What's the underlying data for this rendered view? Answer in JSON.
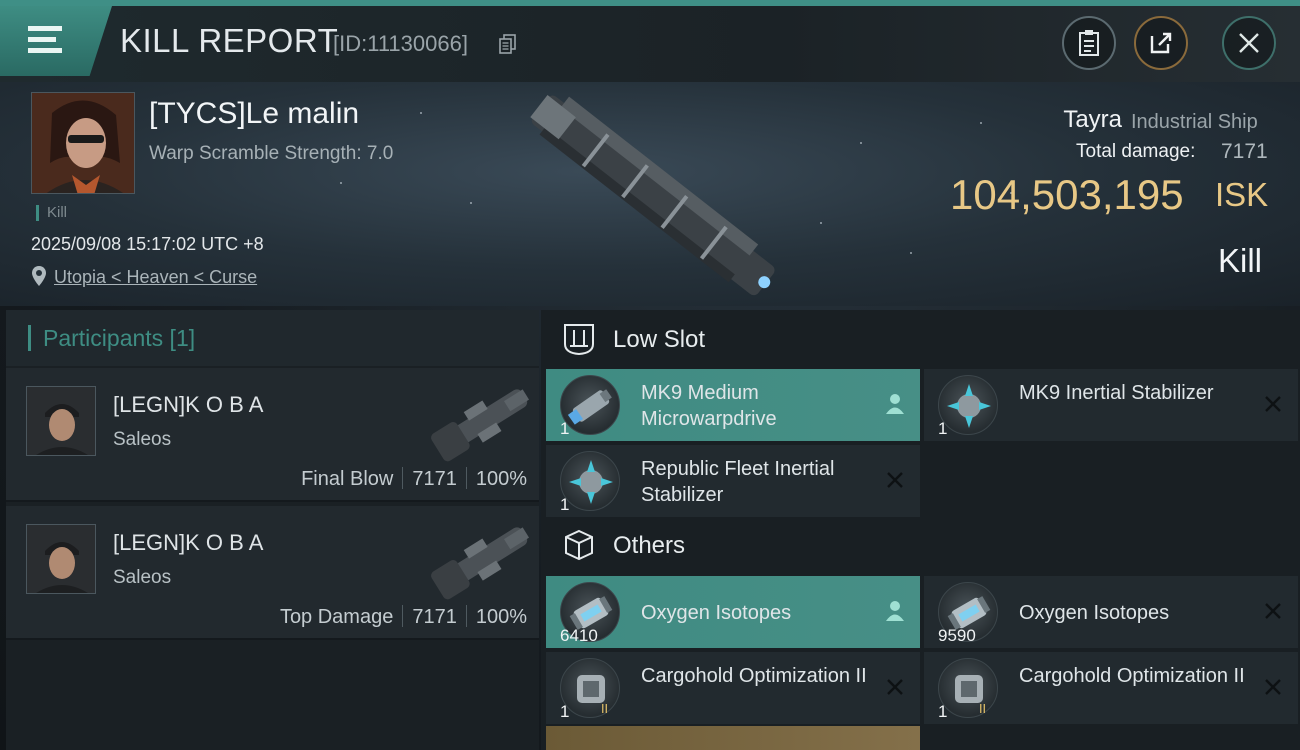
{
  "header": {
    "title": "KILL REPORT",
    "report_id": "[ID:11130066]"
  },
  "victim": {
    "name": "[TYCS]Le malin",
    "warp_scramble": "Warp Scramble Strength: 7.0",
    "tag": "Kill",
    "datetime": "2025/09/08 15:17:02 UTC +8",
    "location": "Utopia < Heaven < Curse"
  },
  "ship": {
    "name": "Tayra",
    "class": "Industrial Ship",
    "total_damage_label": "Total damage:",
    "total_damage": "7171",
    "isk_value": "104,503,195",
    "isk_unit": "ISK",
    "result": "Kill"
  },
  "participants": {
    "title": "Participants [1]",
    "rows": [
      {
        "name": "[LEGN]K O B A",
        "ship": "Saleos",
        "role": "Final Blow",
        "damage": "7171",
        "percent": "100%"
      },
      {
        "name": "[LEGN]K O B A",
        "ship": "Saleos",
        "role": "Top Damage",
        "damage": "7171",
        "percent": "100%"
      }
    ]
  },
  "sections": {
    "low_slot": {
      "title": "Low Slot",
      "items": [
        {
          "name": "MK9 Medium Microwarpdrive",
          "qty": "1",
          "status": "dropped"
        },
        {
          "name": "MK9 Inertial Stabilizer",
          "qty": "1",
          "status": "destroyed"
        },
        {
          "name": "Republic Fleet Inertial Stabilizer",
          "qty": "1",
          "status": "destroyed"
        }
      ]
    },
    "others": {
      "title": "Others",
      "items": [
        {
          "name": "Oxygen Isotopes",
          "qty": "6410",
          "status": "dropped"
        },
        {
          "name": "Oxygen Isotopes",
          "qty": "9590",
          "status": "destroyed"
        },
        {
          "name": "Cargohold Optimization II",
          "qty": "1",
          "status": "destroyed"
        },
        {
          "name": "Cargohold Optimization II",
          "qty": "1",
          "status": "destroyed"
        }
      ]
    }
  },
  "colors": {
    "accent": "#3e8d83",
    "isk_gold": "#e8c886",
    "highlight_row": "#438d84"
  },
  "icons": {
    "menu": "hamburger-icon",
    "copy": "copy-icon",
    "clipboard": "clipboard-icon",
    "share": "share-icon",
    "close": "close-icon",
    "location": "map-pin-icon",
    "low_slot": "low-slot-icon",
    "others": "cube-icon",
    "dropped": "person-icon",
    "destroyed": "x-icon"
  }
}
